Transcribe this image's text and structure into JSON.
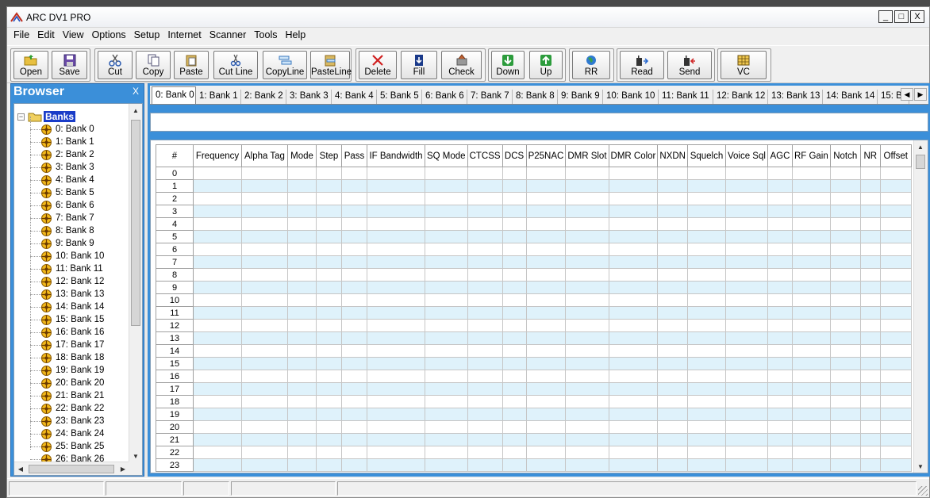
{
  "window": {
    "title": "ARC DV1 PRO",
    "controls": [
      "_",
      "□",
      "X"
    ]
  },
  "menu": [
    "File",
    "Edit",
    "View",
    "Options",
    "Setup",
    "Internet",
    "Scanner",
    "Tools",
    "Help"
  ],
  "toolbar": {
    "open": "Open",
    "save": "Save",
    "cut": "Cut",
    "copy": "Copy",
    "paste": "Paste",
    "cut_line": "Cut Line",
    "copy_line": "CopyLine",
    "paste_line": "PasteLine",
    "delete": "Delete",
    "fill": "Fill",
    "check": "Check",
    "down": "Down",
    "up": "Up",
    "rr": "RR",
    "read": "Read",
    "send": "Send",
    "vc": "VC"
  },
  "browser": {
    "title": "Browser",
    "close": "X",
    "root": "Banks",
    "items": [
      "0: Bank 0",
      "1: Bank 1",
      "2: Bank 2",
      "3: Bank 3",
      "4: Bank 4",
      "5: Bank 5",
      "6: Bank 6",
      "7: Bank 7",
      "8: Bank 8",
      "9: Bank 9",
      "10: Bank 10",
      "11: Bank 11",
      "12: Bank 12",
      "13: Bank 13",
      "14: Bank 14",
      "15: Bank 15",
      "16: Bank 16",
      "17: Bank 17",
      "18: Bank 18",
      "19: Bank 19",
      "20: Bank 20",
      "21: Bank 21",
      "22: Bank 22",
      "23: Bank 23",
      "24: Bank 24",
      "25: Bank 25",
      "26: Bank 26"
    ]
  },
  "tabs": [
    "0: Bank 0",
    "1: Bank 1",
    "2: Bank 2",
    "3: Bank 3",
    "4: Bank 4",
    "5: Bank 5",
    "6: Bank 6",
    "7: Bank 7",
    "8: Bank 8",
    "9: Bank 9",
    "10: Bank 10",
    "11: Bank 11",
    "12: Bank 12",
    "13: Bank 13",
    "14: Bank 14",
    "15: B"
  ],
  "active_tab": 0,
  "grid": {
    "columns": [
      "#",
      "Frequency",
      "Alpha Tag",
      "Mode",
      "Step",
      "Pass",
      "IF Bandwidth",
      "SQ Mode",
      "CTCSS",
      "DCS",
      "P25NAC",
      "DMR Slot",
      "DMR Color",
      "NXDN",
      "Squelch",
      "Voice Sql",
      "AGC",
      "RF Gain",
      "Notch",
      "NR",
      "Offset"
    ],
    "rows": [
      "0",
      "1",
      "2",
      "3",
      "4",
      "5",
      "6",
      "7",
      "8",
      "9",
      "10",
      "11",
      "12",
      "13",
      "14",
      "15",
      "16",
      "17",
      "18",
      "19",
      "20",
      "21",
      "22",
      "23"
    ]
  },
  "colors": {
    "panel_blue": "#3b8fd9",
    "row_alt": "#dff2fb",
    "tree_selected": "#1a3cc8"
  }
}
